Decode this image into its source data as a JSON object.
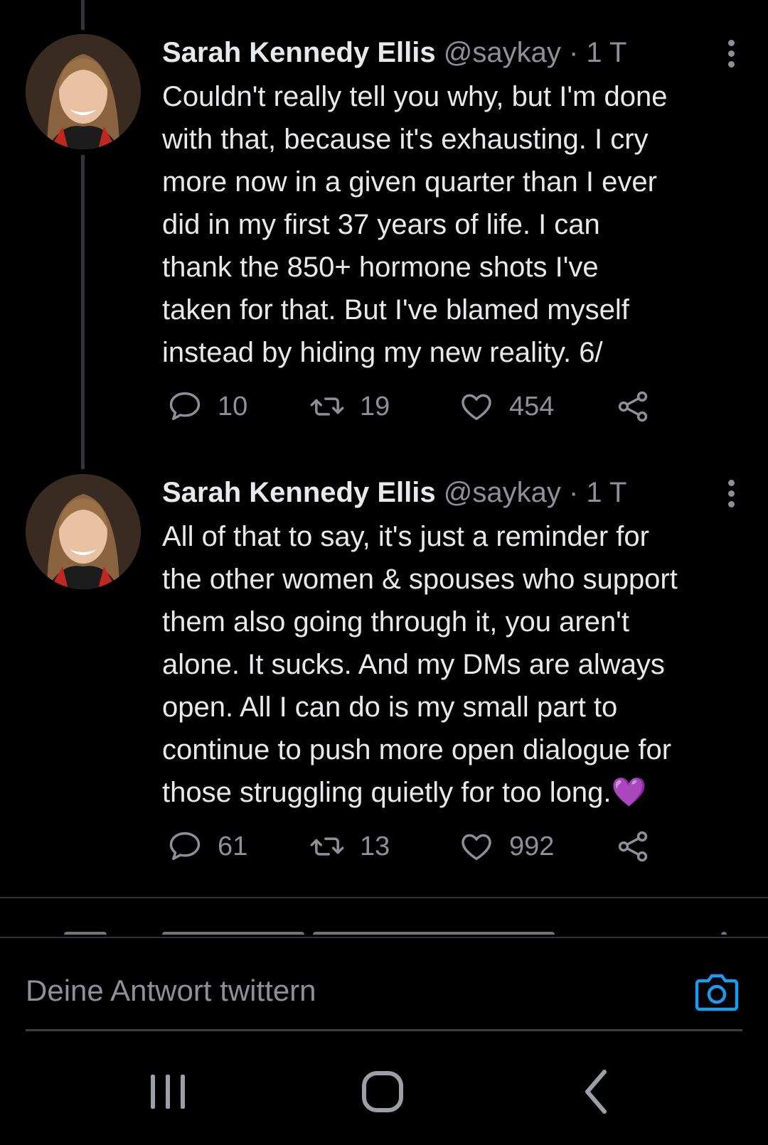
{
  "tweets": [
    {
      "author": "Sarah Kennedy Ellis",
      "handle": "@saykay",
      "separator": "·",
      "time": "1 T",
      "text": "Couldn't really tell you why, but I'm done\nwith that, because it's exhausting. I cry\nmore now in a given quarter than I ever\ndid in my first 37 years of life. I can\nthank the 850+ hormone shots I've\ntaken for that. But I've blamed myself\ninstead by hiding my new reality. 6/",
      "replies": "10",
      "retweets": "19",
      "likes": "454"
    },
    {
      "author": "Sarah Kennedy Ellis",
      "handle": "@saykay",
      "separator": "·",
      "time": "1 T",
      "text": "All of that to say, it's just a reminder for\nthe other women & spouses who support\nthem also going through it, you aren't\nalone. It sucks. And my DMs are always\nopen. All I can do is my small part to\ncontinue to push more open dialogue for\nthose struggling quietly for too long.",
      "emoji": "💜",
      "replies": "61",
      "retweets": "13",
      "likes": "992"
    }
  ],
  "reply": {
    "placeholder": "Deine Antwort twittern"
  },
  "icons": {
    "reply": "speech-bubble-icon",
    "retweet": "retweet-icon",
    "like": "heart-icon",
    "share": "share-icon",
    "more": "more-vertical-icon",
    "camera": "camera-icon",
    "nav_recents": "recents-icon",
    "nav_home": "home-icon",
    "nav_back": "back-icon"
  },
  "colors": {
    "background": "#000000",
    "text": "#e7e9ea",
    "secondary": "#8b9197",
    "accent": "#1d9bf0",
    "emoji": "#b794f6"
  }
}
